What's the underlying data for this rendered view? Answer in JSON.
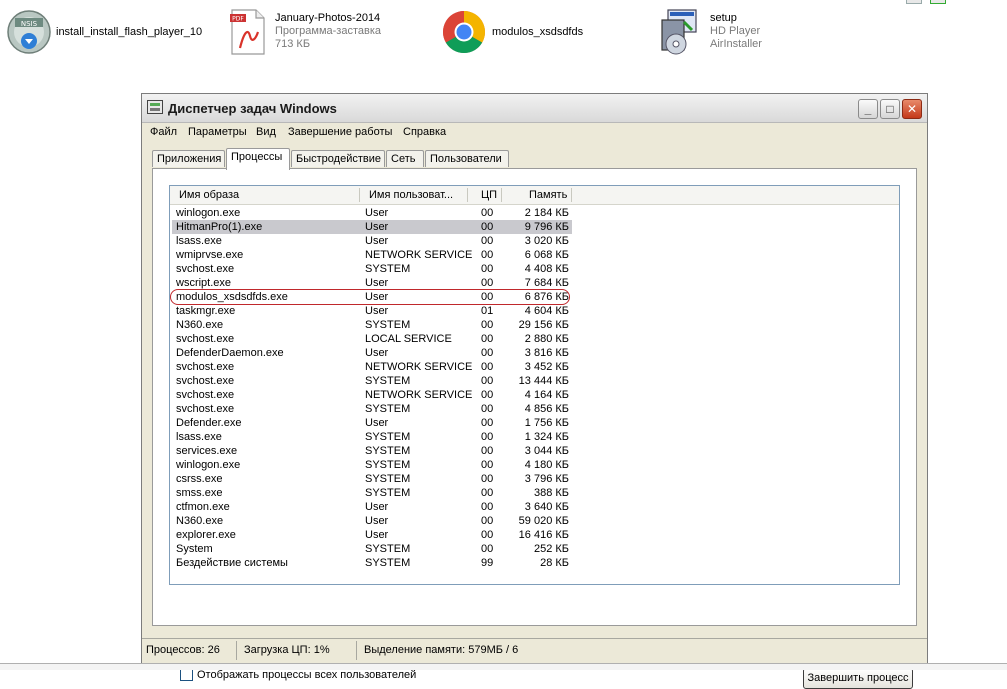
{
  "desktop": {
    "icons": [
      {
        "name": "install_install_flash_player_10",
        "line2": "",
        "line3": "",
        "icon": "installer-disc-icon"
      },
      {
        "name": "January-Photos-2014",
        "line2": "Программа-заставка",
        "line3": "713 КБ",
        "icon": "pdf-file-icon"
      },
      {
        "name": "modulos_xsdsdfds",
        "line2": "",
        "line3": "",
        "icon": "chrome-icon"
      },
      {
        "name": "setup",
        "line2": "HD Player",
        "line3": "AirInstaller",
        "icon": "setup-installer-icon"
      }
    ]
  },
  "window": {
    "title": "Диспетчер задач Windows",
    "menu": [
      "Файл",
      "Параметры",
      "Вид",
      "Завершение работы",
      "Справка"
    ],
    "tabs": [
      "Приложения",
      "Процессы",
      "Быстродействие",
      "Сеть",
      "Пользователи"
    ],
    "active_tab": "Процессы",
    "columns": {
      "name": "Имя образа",
      "user": "Имя пользоват...",
      "cpu": "ЦП",
      "mem": "Память"
    },
    "processes": [
      {
        "name": "winlogon.exe",
        "user": "User",
        "cpu": "00",
        "mem": "2 184 КБ"
      },
      {
        "name": "HitmanPro(1).exe",
        "user": "User",
        "cpu": "00",
        "mem": "9 796 КБ"
      },
      {
        "name": "lsass.exe",
        "user": "User",
        "cpu": "00",
        "mem": "3 020 КБ"
      },
      {
        "name": "wmiprvse.exe",
        "user": "NETWORK SERVICE",
        "cpu": "00",
        "mem": "6 068 КБ"
      },
      {
        "name": "svchost.exe",
        "user": "SYSTEM",
        "cpu": "00",
        "mem": "4 408 КБ"
      },
      {
        "name": "wscript.exe",
        "user": "User",
        "cpu": "00",
        "mem": "7 684 КБ"
      },
      {
        "name": "modulos_xsdsdfds.exe",
        "user": "User",
        "cpu": "00",
        "mem": "6 876 КБ"
      },
      {
        "name": "taskmgr.exe",
        "user": "User",
        "cpu": "01",
        "mem": "4 604 КБ"
      },
      {
        "name": "N360.exe",
        "user": "SYSTEM",
        "cpu": "00",
        "mem": "29 156 КБ"
      },
      {
        "name": "svchost.exe",
        "user": "LOCAL SERVICE",
        "cpu": "00",
        "mem": "2 880 КБ"
      },
      {
        "name": "DefenderDaemon.exe",
        "user": "User",
        "cpu": "00",
        "mem": "3 816 КБ"
      },
      {
        "name": "svchost.exe",
        "user": "NETWORK SERVICE",
        "cpu": "00",
        "mem": "3 452 КБ"
      },
      {
        "name": "svchost.exe",
        "user": "SYSTEM",
        "cpu": "00",
        "mem": "13 444 КБ"
      },
      {
        "name": "svchost.exe",
        "user": "NETWORK SERVICE",
        "cpu": "00",
        "mem": "4 164 КБ"
      },
      {
        "name": "svchost.exe",
        "user": "SYSTEM",
        "cpu": "00",
        "mem": "4 856 КБ"
      },
      {
        "name": "Defender.exe",
        "user": "User",
        "cpu": "00",
        "mem": "1 756 КБ"
      },
      {
        "name": "lsass.exe",
        "user": "SYSTEM",
        "cpu": "00",
        "mem": "1 324 КБ"
      },
      {
        "name": "services.exe",
        "user": "SYSTEM",
        "cpu": "00",
        "mem": "3 044 КБ"
      },
      {
        "name": "winlogon.exe",
        "user": "SYSTEM",
        "cpu": "00",
        "mem": "4 180 КБ"
      },
      {
        "name": "csrss.exe",
        "user": "SYSTEM",
        "cpu": "00",
        "mem": "3 796 КБ"
      },
      {
        "name": "smss.exe",
        "user": "SYSTEM",
        "cpu": "00",
        "mem": "388 КБ"
      },
      {
        "name": "ctfmon.exe",
        "user": "User",
        "cpu": "00",
        "mem": "3 640 КБ"
      },
      {
        "name": "N360.exe",
        "user": "User",
        "cpu": "00",
        "mem": "59 020 КБ"
      },
      {
        "name": "explorer.exe",
        "user": "User",
        "cpu": "00",
        "mem": "16 416 КБ"
      },
      {
        "name": "System",
        "user": "SYSTEM",
        "cpu": "00",
        "mem": "252 КБ"
      },
      {
        "name": "Бездействие системы",
        "user": "SYSTEM",
        "cpu": "99",
        "mem": "28 КБ"
      }
    ],
    "selected_row": "HitmanPro(1).exe",
    "highlighted_row": "modulos_xsdsdfds.exe",
    "show_all_label": "Отображать процессы всех пользователей",
    "end_process_label": "Завершить процесс",
    "status": {
      "processes": "Процессов: 26",
      "cpu": "Загрузка ЦП: 1%",
      "memory": "Выделение памяти: 579МБ / 6"
    },
    "colors": {
      "selection": "#c9c9ce",
      "highlight_oval": "#c0282c",
      "close_button": "#c4391a"
    }
  }
}
